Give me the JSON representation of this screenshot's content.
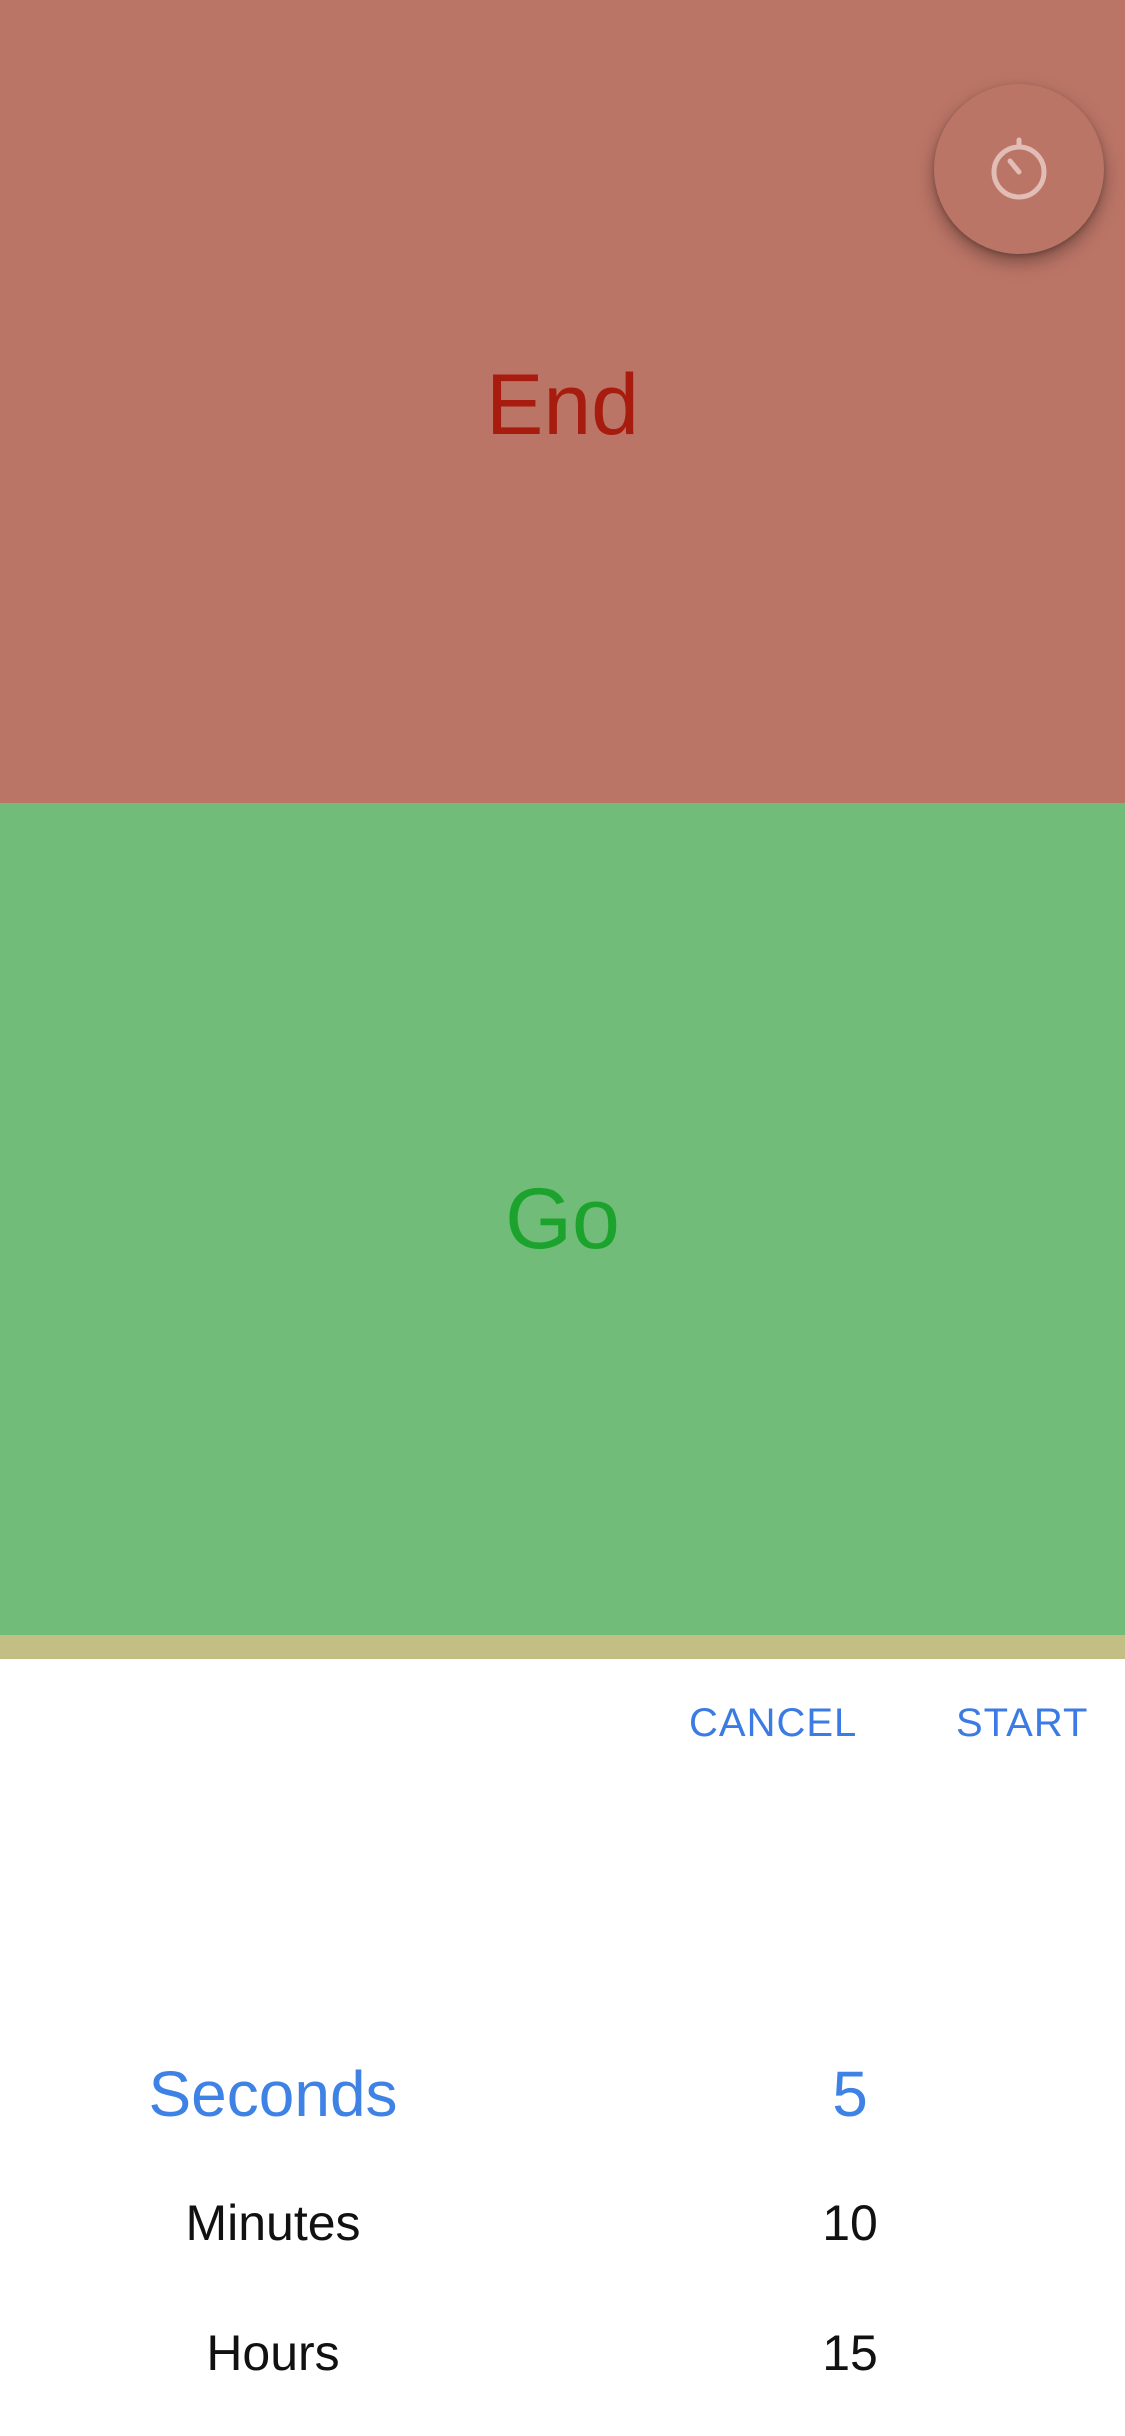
{
  "zones": {
    "end_label": "End",
    "go_label": "Go"
  },
  "timer_button": {
    "icon": "stopwatch-icon"
  },
  "sheet": {
    "cancel_label": "CANCEL",
    "start_label": "START"
  },
  "picker": {
    "units": [
      "Seconds",
      "Minutes",
      "Hours"
    ],
    "values": [
      "5",
      "10",
      "15"
    ],
    "selected_unit": "Seconds",
    "selected_value": "5"
  },
  "colors": {
    "end_background": "#bb7567",
    "end_text": "#a81c10",
    "go_background": "#71bc78",
    "go_text": "#1ba32d",
    "accent": "#3b7be3"
  }
}
